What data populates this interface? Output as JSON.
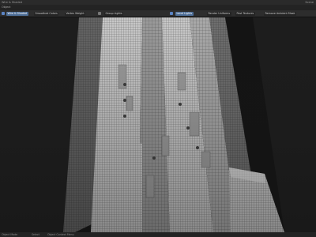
{
  "window": {
    "title": "Wire & Shaded",
    "right_label": "Scene"
  },
  "menubar": {
    "label": "Object"
  },
  "toolbar": {
    "items": [
      {
        "label": "Wire & Shaded",
        "active": true
      },
      {
        "label": "Smoothed Colors"
      },
      {
        "label": "Vertex Weight"
      },
      {
        "label": "Group Lights"
      },
      {
        "label": "Local Lights",
        "active": true
      },
      {
        "label": "Render Uniforms"
      },
      {
        "label": "Post Textures"
      },
      {
        "label": "Remove Ambient Mask"
      }
    ],
    "accent_color": "#4f6f98"
  },
  "statusbar": {
    "left": "Object Mode",
    "middle": "Select",
    "right": "Object Context Menu"
  },
  "viewport": {
    "subject": "wireframe tower mesh",
    "colors": {
      "background": "#1d1d1d",
      "mesh_light": "#d9d9d9",
      "mesh_mid": "#a7a7a7",
      "mesh_dark": "#5e5e5e",
      "shadow": "#1a1a1a"
    }
  }
}
